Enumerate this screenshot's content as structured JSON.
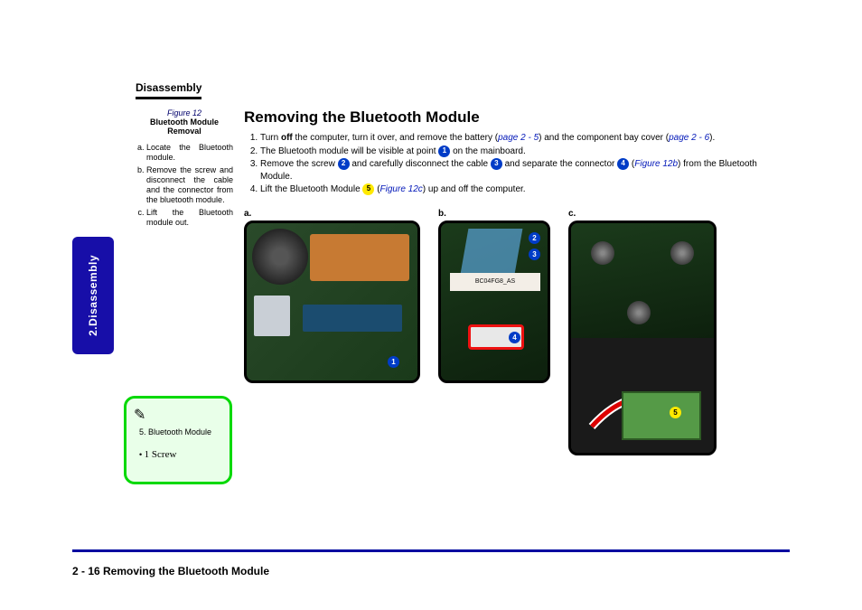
{
  "header": {
    "section": "Disassembly"
  },
  "side_tab": {
    "label": "2.Disassembly"
  },
  "figure_caption": {
    "title": "Figure 12",
    "subtitle": "Bluetooth Module Removal",
    "items": [
      "Locate the Bluetooth module.",
      "Remove the screw and disconnect the cable and the connector from the bluetooth module.",
      "Lift the Bluetooth module out."
    ]
  },
  "main": {
    "title": "Removing the Bluetooth Module",
    "steps": {
      "s1a": "Turn ",
      "s1b": "off",
      "s1c": " the computer, turn it over, and remove the battery (",
      "s1link1": "page 2 - 5",
      "s1d": ") and the component bay cover (",
      "s1link2": "page 2 - 6",
      "s1e": ").",
      "s2a": "The Bluetooth module will be visible at point ",
      "s2b": " on the mainboard.",
      "s3a": "Remove the screw ",
      "s3b": " and carefully disconnect the cable ",
      "s3c": " and separate the connector ",
      "s3d": " (",
      "s3link": "Figure 12b",
      "s3e": ") from the Bluetooth Module.",
      "s4a": "Lift the Bluetooth Module ",
      "s4b": " (",
      "s4link": "Figure 12c",
      "s4c": ") up and off the computer."
    },
    "fig_labels": {
      "a": "a.",
      "b": "b.",
      "c": "c."
    },
    "badges": {
      "b1": "1",
      "b2": "2",
      "b3": "3",
      "b4": "4",
      "b5": "5"
    },
    "figc_label_text": "BC04FG8_AS"
  },
  "notes": {
    "item1": "Bluetooth Module",
    "item2": "1 Screw"
  },
  "footer": {
    "text": "2 - 16  Removing the Bluetooth Module"
  }
}
